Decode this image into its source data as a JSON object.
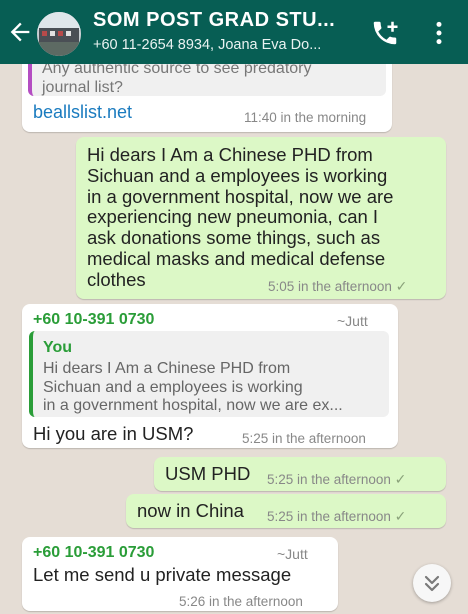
{
  "header": {
    "title": "SOM POST GRAD STU...",
    "subtitle": "+60 11-2654 8934, Joana Eva Do...",
    "icons": [
      "back-arrow-icon",
      "group-avatar",
      "add-call-icon",
      "more-vert-icon"
    ],
    "color": "#075e54"
  },
  "messages": [
    {
      "type": "incoming",
      "quote_text": "Any authentic source to see predatory journal list?",
      "link": "beallslist.net",
      "time": "11:40 in the morning"
    },
    {
      "type": "outgoing",
      "lines": [
        "Hi dears I Am a Chinese PHD from",
        "Sichuan and a employees is working",
        "in a government hospital, now we are",
        "experiencing new pneumonia, can I",
        "ask donations some things, such as",
        "medical masks and medical defense",
        "clothes"
      ],
      "time": "5:05 in the afternoon"
    },
    {
      "type": "incoming",
      "sender": "+60 10-391 0730",
      "alias": "~Jutt",
      "quote_author": "You",
      "quote_lines": [
        "Hi dears I Am a Chinese PHD from",
        "Sichuan and a employees is working",
        "in a government hospital, now we are ex..."
      ],
      "text": "Hi you are in USM?",
      "time": "5:25 in the afternoon"
    },
    {
      "type": "outgoing",
      "text": "USM PHD",
      "time": "5:25 in the afternoon"
    },
    {
      "type": "outgoing",
      "text": "now in China",
      "time": "5:25 in the afternoon"
    },
    {
      "type": "incoming",
      "sender": "+60 10-391 0730",
      "alias": "~Jutt",
      "text": "Let me send u private message",
      "time": "5:26 in the afternoon"
    }
  ],
  "tick_glyph": "✓",
  "colors": {
    "outgoing": "#dcf8c6",
    "incoming": "#ffffff",
    "sender": "#2a9d38",
    "link": "#1a7bbf"
  }
}
